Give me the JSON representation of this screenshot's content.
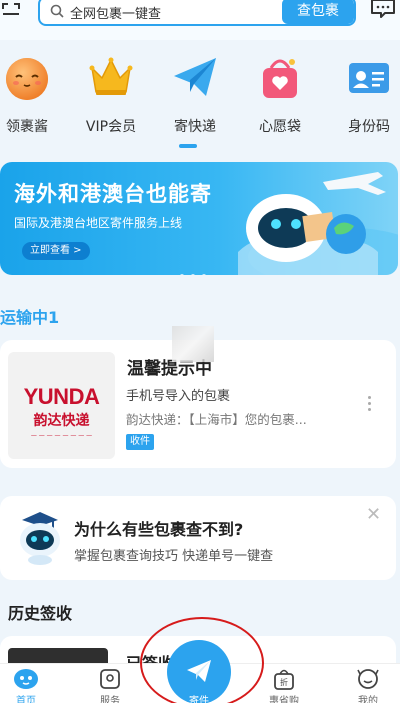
{
  "header": {
    "search_placeholder": "全网包裹一键查",
    "search_button": "查包裹"
  },
  "quicknav": {
    "items": [
      {
        "label": "领裹酱",
        "icon": "mascot-icon"
      },
      {
        "label": "VIP会员",
        "icon": "crown-icon"
      },
      {
        "label": "寄快递",
        "icon": "paper-plane-icon"
      },
      {
        "label": "心愿袋",
        "icon": "gift-bag-icon"
      },
      {
        "label": "身份码",
        "icon": "id-card-icon"
      }
    ],
    "active_index": 2
  },
  "banner": {
    "title": "海外和港澳台也能寄",
    "subtitle": "国际及港澳台地区寄件服务上线",
    "cta": "立即查看 >",
    "slide_count": 3
  },
  "transit": {
    "title": "运输中1"
  },
  "package": {
    "carrier_logo_en": "YUNDA",
    "carrier_logo_cn": "韵达快递",
    "title": "温馨提示中",
    "desc": "手机号导入的包裹",
    "status": "韵达快递：【上海市】您的包裹...",
    "tag": "收件"
  },
  "tip": {
    "title": "为什么有些包裹查不到?",
    "desc": "掌握包裹查询技巧 快递单号一键查"
  },
  "history": {
    "title": "历史签收",
    "item_label": "已签收"
  },
  "tabbar": {
    "items": [
      {
        "label": "首页",
        "icon": "home-icon"
      },
      {
        "label": "服务",
        "icon": "service-icon"
      },
      {
        "label": "寄件",
        "icon": "send-plane-icon"
      },
      {
        "label": "惠省购",
        "icon": "discount-bag-icon"
      },
      {
        "label": "我的",
        "icon": "profile-icon"
      }
    ]
  },
  "colors": {
    "accent": "#2ca3ee",
    "brand_red": "#c8102e",
    "annotation": "#d61b1b"
  }
}
